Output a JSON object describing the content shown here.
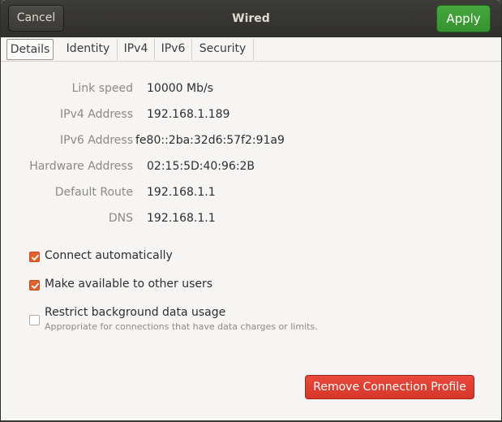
{
  "header": {
    "title": "Wired",
    "cancel_label": "Cancel",
    "apply_label": "Apply"
  },
  "tabs": [
    {
      "label": "Details",
      "active": true
    },
    {
      "label": "Identity",
      "active": false
    },
    {
      "label": "IPv4",
      "active": false
    },
    {
      "label": "IPv6",
      "active": false
    },
    {
      "label": "Security",
      "active": false
    }
  ],
  "details": {
    "link_speed": {
      "label": "Link speed",
      "value": "10000 Mb/s"
    },
    "ipv4": {
      "label": "IPv4 Address",
      "value": "192.168.1.189"
    },
    "ipv6": {
      "label": "IPv6 Address",
      "value": "fe80::2ba:32d6:57f2:91a9"
    },
    "hw": {
      "label": "Hardware Address",
      "value": "02:15:5D:40:96:2B"
    },
    "route": {
      "label": "Default Route",
      "value": "192.168.1.1"
    },
    "dns": {
      "label": "DNS",
      "value": "192.168.1.1"
    }
  },
  "options": {
    "connect_auto": {
      "label": "Connect automatically",
      "checked": true
    },
    "available_users": {
      "label": "Make available to other users",
      "checked": true
    },
    "restrict_bg": {
      "label": "Restrict background data usage",
      "sublabel": "Appropriate for connections that have data charges or limits.",
      "checked": false
    }
  },
  "remove_label": "Remove Connection Profile",
  "colors": {
    "apply": "#3ea037",
    "checkbox_on": "#e1612e",
    "remove": "#df3f31"
  }
}
